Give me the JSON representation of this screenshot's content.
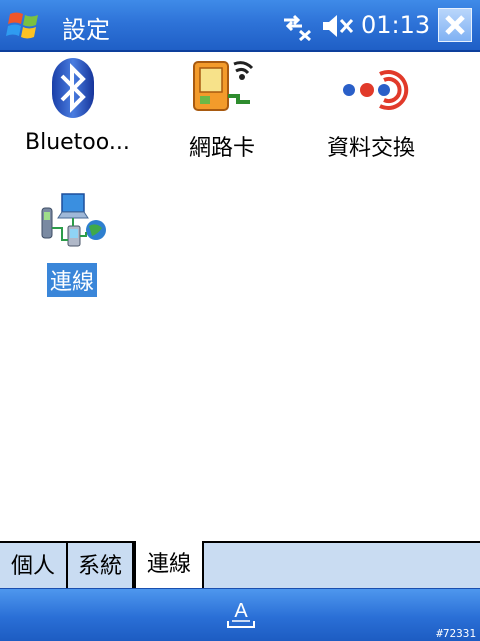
{
  "titlebar": {
    "title": "設定",
    "clock": "01:13"
  },
  "icons": [
    {
      "label": "Bluetoo...",
      "icon": "bluetooth-icon",
      "selected": false
    },
    {
      "label": "網路卡",
      "icon": "network-card-icon",
      "selected": false
    },
    {
      "label": "資料交換",
      "icon": "beam-icon",
      "selected": false
    },
    {
      "label": "連線",
      "icon": "connections-icon",
      "selected": true
    }
  ],
  "tabs": [
    {
      "label": "個人",
      "active": false
    },
    {
      "label": "系統",
      "active": false
    },
    {
      "label": "連線",
      "active": true
    }
  ],
  "softbar": {
    "sip_icon": "keyboard-input-icon"
  },
  "watermark": "#72331",
  "colors": {
    "titlebar": "#2e73d8",
    "selection": "#3a86d9",
    "tabbar": "#c9dcf2"
  }
}
